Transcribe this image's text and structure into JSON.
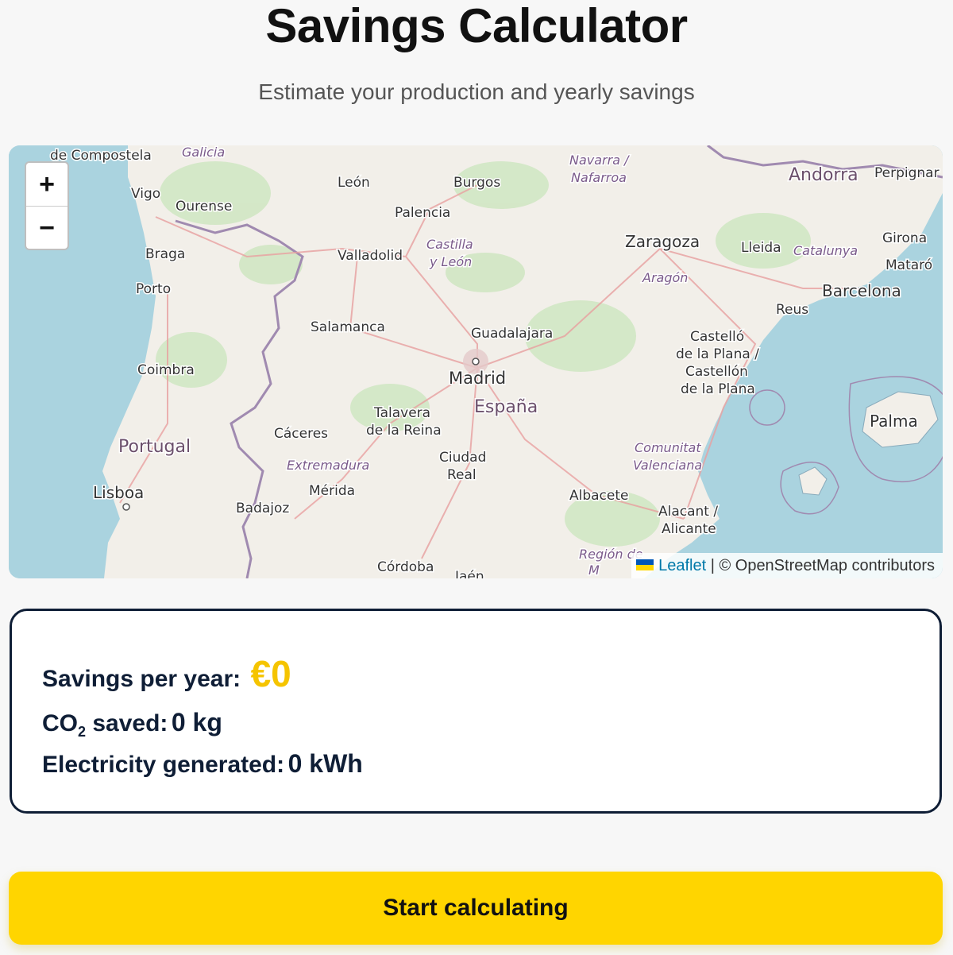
{
  "header": {
    "title": "Savings Calculator",
    "subtitle": "Estimate your production and yearly savings"
  },
  "map": {
    "zoom_in_label": "+",
    "zoom_out_label": "−",
    "attribution_link": "Leaflet",
    "attribution_text": " | © OpenStreetMap contributors",
    "labels": {
      "de_compostela": "de Compostela",
      "galicia": "Galicia",
      "vigo": "Vigo",
      "ourense": "Ourense",
      "leon": "León",
      "burgos": "Burgos",
      "palencia": "Palencia",
      "navarra": "Navarra /",
      "nafarroa": "Nafarroa",
      "andorra": "Andorra",
      "perpignan": "Perpignar",
      "braga": "Braga",
      "valladolid": "Valladolid",
      "castilla": "Castilla",
      "y_leon": "y León",
      "zaragoza": "Zaragoza",
      "lleida": "Lleida",
      "catalunya": "Catalunya",
      "girona": "Girona",
      "mataro": "Mataró",
      "porto": "Porto",
      "aragon": "Aragón",
      "reus": "Reus",
      "barcelona": "Barcelona",
      "salamanca": "Salamanca",
      "guadalajara": "Guadalajara",
      "castello1": "Castelló",
      "castello2": "de la Plana /",
      "castello3": "Castellón",
      "castello4": "de la Plana",
      "coimbra": "Coimbra",
      "madrid": "Madrid",
      "espana": "España",
      "talavera1": "Talavera",
      "talavera2": "de la Reina",
      "palma": "Palma",
      "caceres": "Cáceres",
      "portugal": "Portugal",
      "extremadura": "Extremadura",
      "ciudad1": "Ciudad",
      "ciudad2": "Real",
      "comunitat1": "Comunitat",
      "comunitat2": "Valenciana",
      "merida": "Mérida",
      "lisboa": "Lisboa",
      "badajoz": "Badajoz",
      "albacete": "Albacete",
      "alacant1": "Alacant /",
      "alacant2": "Alicante",
      "region1": "Región de",
      "region2": "M",
      "cordoba": "Córdoba",
      "jaen": "Jaén"
    }
  },
  "results": {
    "savings_label": "Savings per year:",
    "savings_value": "€0",
    "co2_label_prefix": "CO",
    "co2_label_sub": "2",
    "co2_label_suffix": " saved:",
    "co2_value": "0 kg",
    "electricity_label": "Electricity generated:",
    "electricity_value": "0 kWh"
  },
  "cta": {
    "label": "Start calculating"
  },
  "colors": {
    "accent": "#ffd500",
    "savings_value": "#f5c400",
    "text_dark": "#0f1e36",
    "sea": "#aad3df",
    "land": "#f2efe9"
  }
}
